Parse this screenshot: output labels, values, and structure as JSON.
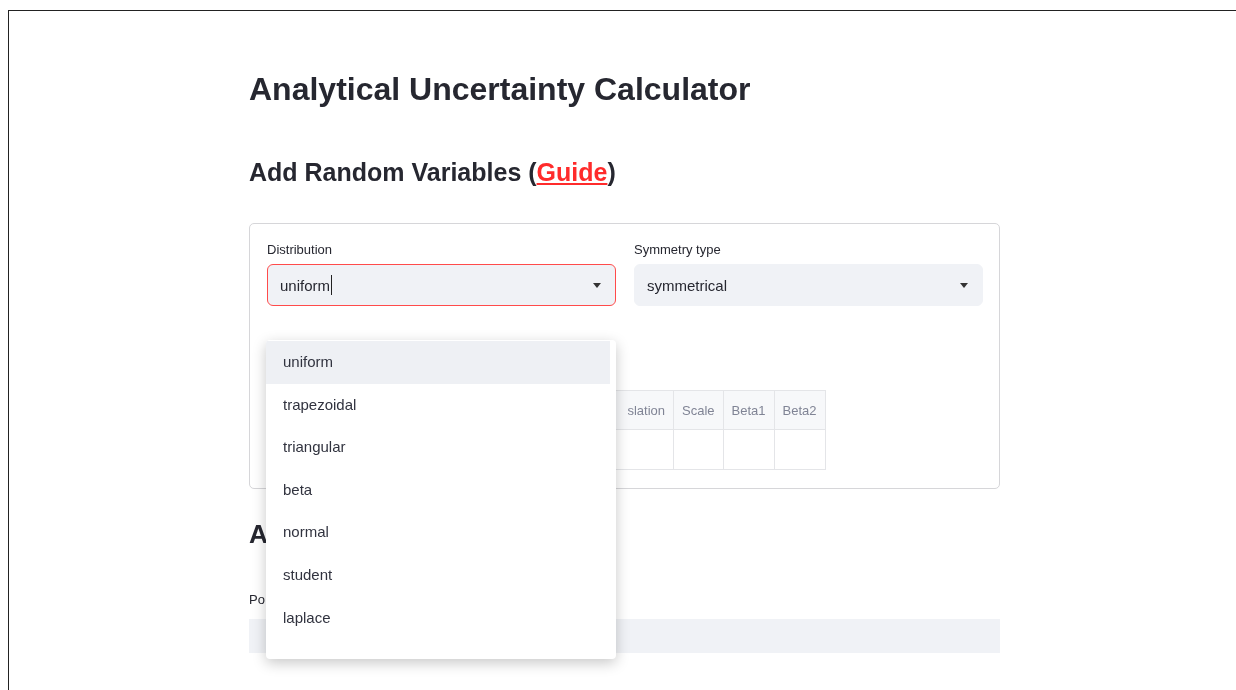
{
  "title": "Analytical Uncertainty Calculator",
  "section_heading": {
    "text": "Add Random Variables (",
    "link": "Guide",
    "suffix": ")"
  },
  "form": {
    "distribution": {
      "label": "Distribution",
      "value": "uniform",
      "focused": true
    },
    "symmetry": {
      "label": "Symmetry type",
      "value": "symmetrical"
    },
    "table": {
      "columns": [
        "slation",
        "Scale",
        "Beta1",
        "Beta2"
      ]
    }
  },
  "dropdown": {
    "options": [
      {
        "label": "uniform",
        "selected": true
      },
      {
        "label": "trapezoidal",
        "selected": false
      },
      {
        "label": "triangular",
        "selected": false
      },
      {
        "label": "beta",
        "selected": false
      },
      {
        "label": "normal",
        "selected": false
      },
      {
        "label": "student",
        "selected": false
      },
      {
        "label": "laplace",
        "selected": false
      }
    ]
  },
  "second_section": {
    "heading": "A",
    "field_label": "Po"
  }
}
